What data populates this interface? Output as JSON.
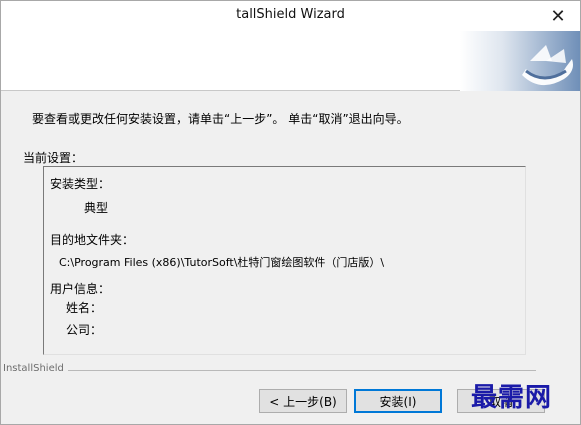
{
  "window": {
    "title": "tallShield Wizard",
    "close_glyph": "✕"
  },
  "banner": {
    "logo_icon": "installshield-swirl-logo"
  },
  "content": {
    "instruction": "要查看或更改任何安装设置，请单击“上一步”。 单击“取消”退出向导。",
    "current_settings_label": "当前设置：",
    "settings": {
      "setup_type_label": "安装类型：",
      "setup_type_value": "典型",
      "dest_folder_label": "目的地文件夹：",
      "dest_folder_value": "C:\\Program Files (x86)\\TutorSoft\\杜特门窗绘图软件（门店版）\\",
      "user_info_label": "用户信息：",
      "name_label": "姓名：",
      "company_label": "公司："
    }
  },
  "footer": {
    "brand": "InstallShield",
    "back_button": "< 上一步(B)",
    "install_button": "安装(I)",
    "cancel_button": "取消"
  },
  "watermark": "最需网",
  "colors": {
    "window_bg": "#f0f0f0",
    "focus_border": "#0078d7",
    "logo_blue": "#5a7fae",
    "watermark": "#1a1aa8"
  }
}
